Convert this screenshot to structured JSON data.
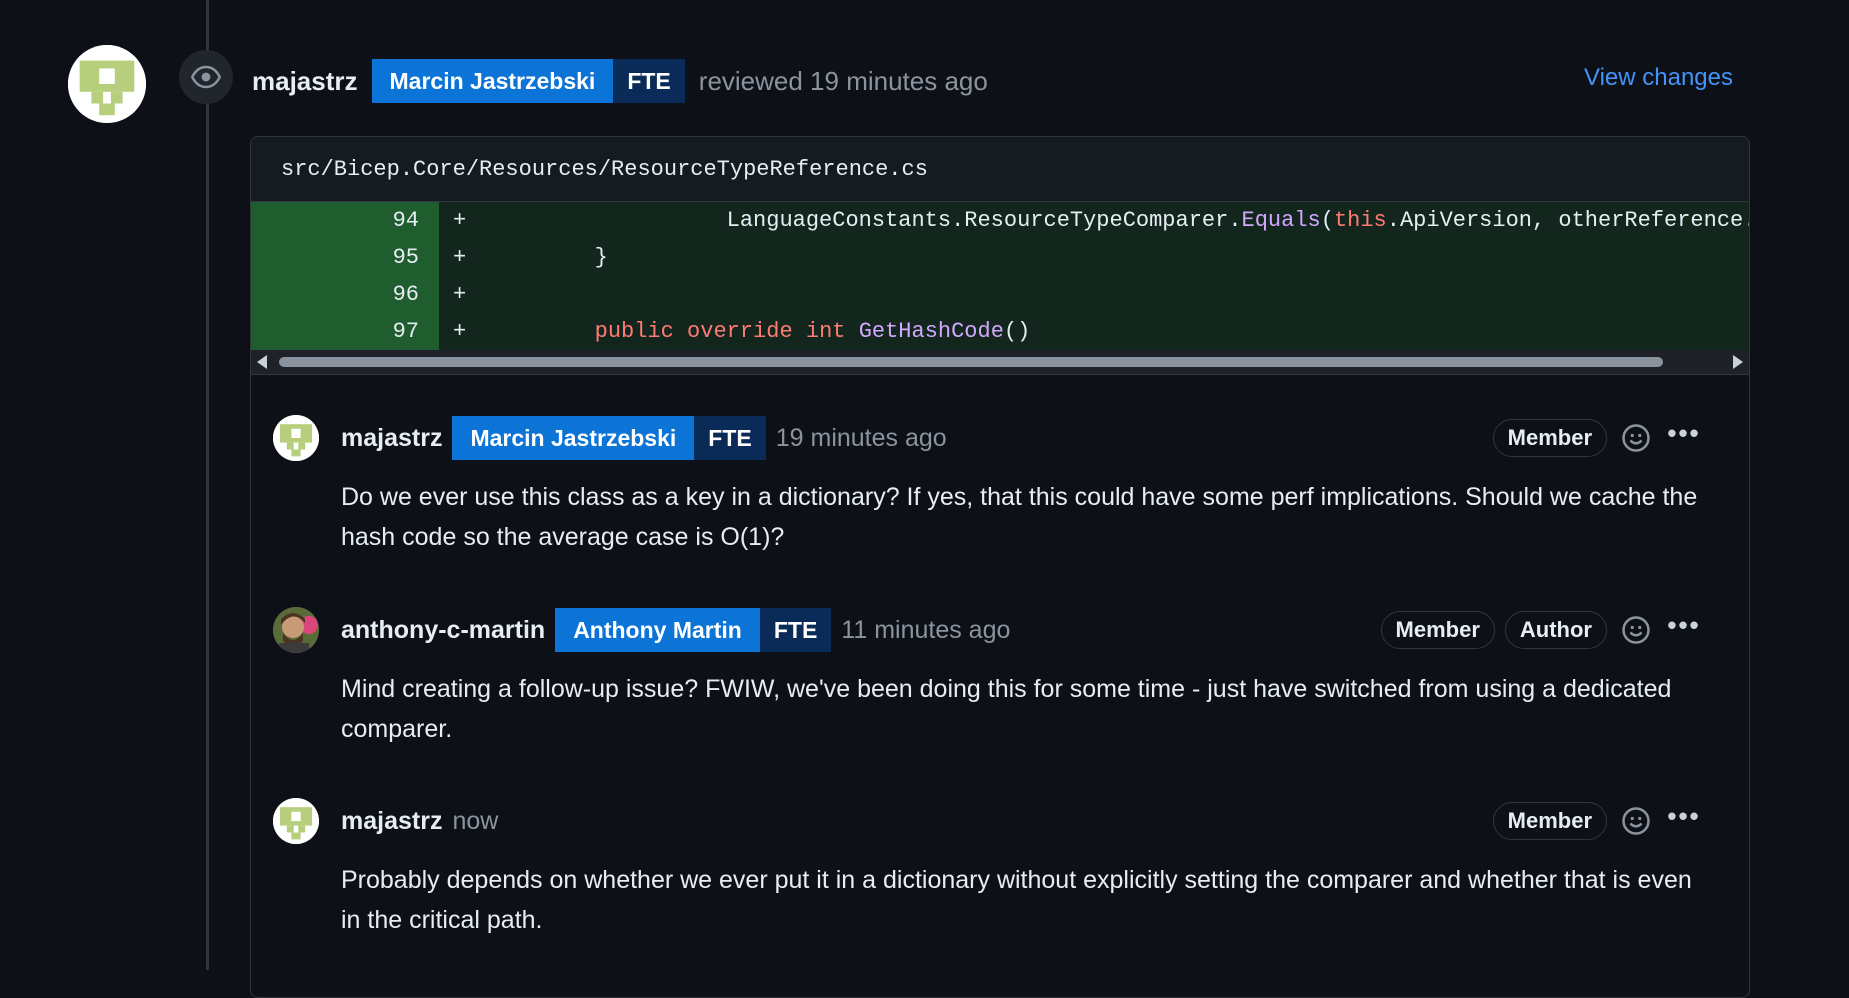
{
  "review": {
    "username": "majastrz",
    "real_name": "Marcin Jastrzebski",
    "org_badge": "FTE",
    "action_text": "reviewed 19 minutes ago",
    "view_changes_label": "View changes"
  },
  "file_path": "src/Bicep.Core/Resources/ResourceTypeReference.cs",
  "diff": {
    "lines": [
      {
        "number": "94",
        "sign": "+"
      },
      {
        "number": "95",
        "sign": "+"
      },
      {
        "number": "96",
        "sign": "+"
      },
      {
        "number": "97",
        "sign": "+"
      }
    ],
    "line94": {
      "part1": "LanguageConstants.ResourceTypeComparer.",
      "method": "Equals",
      "paren": "(",
      "keyword": "this",
      "part2": ".ApiVersion, otherReference.ApiVersio"
    },
    "line95": {
      "text": "}"
    },
    "line97": {
      "kw1": "public",
      "kw2": "override",
      "kw3": "int",
      "method": "GetHashCode",
      "tail": "()"
    }
  },
  "comments": [
    {
      "username": "majastrz",
      "real_name": "Marcin Jastrzebski",
      "org_badge": "FTE",
      "time": "19 minutes ago",
      "badges": [
        "Member"
      ],
      "body": "Do we ever use this class as a key in a dictionary? If yes, that this could have some perf implications. Should we cache the hash code so the average case is O(1)?"
    },
    {
      "username": "anthony-c-martin",
      "real_name": "Anthony Martin",
      "org_badge": "FTE",
      "time": "11 minutes ago",
      "badges": [
        "Member",
        "Author"
      ],
      "body": "Mind creating a follow-up issue? FWIW, we've been doing this for some time - just have switched from using a dedicated comparer."
    },
    {
      "username": "majastrz",
      "time": "now",
      "badges": [
        "Member"
      ],
      "body": "Probably depends on whether we ever put it in a dictionary without explicitly setting the comparer and whether that is even in the critical path."
    }
  ],
  "icons": {
    "eye": "eye-icon",
    "smiley": "smiley-icon",
    "more": "kebab-horizontal-icon",
    "more_glyph": "•••"
  },
  "colors": {
    "background": "#0d1117",
    "link": "#4493f8",
    "badge_blue": "#0d74d7",
    "badge_dark": "#0a2a57",
    "added_line_bg": "#12261e",
    "added_number_bg": "#1f5c2e",
    "keyword": "#ff7b72",
    "function": "#d2a8ff"
  }
}
